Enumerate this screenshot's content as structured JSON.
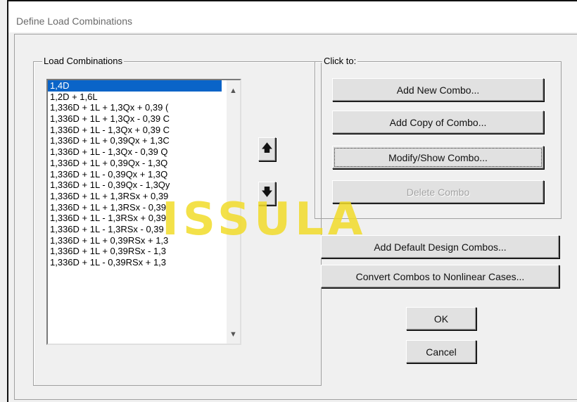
{
  "window": {
    "title": "Define Load Combinations"
  },
  "load_group": {
    "label": "Load Combinations",
    "items": [
      "1,4D",
      "1,2D + 1,6L",
      "1,336D + 1L + 1,3Qx + 0,39 (",
      "1,336D + 1L + 1,3Qx - 0,39 C",
      "1,336D + 1L - 1,3Qx + 0,39 C",
      "1,336D + 1L + 0,39Qx + 1,3C",
      "1,336D + 1L - 1,3Qx - 0,39 Q",
      "1,336D + 1L + 0,39Qx - 1,3Q",
      "1,336D + 1L - 0,39Qx + 1,3Q",
      "1,336D + 1L - 0,39Qx - 1,3Qy",
      "1,336D + 1L + 1,3RSx + 0,39",
      "1,336D + 1L + 1,3RSx - 0,39",
      "1,336D + 1L - 1,3RSx + 0,39",
      "1,336D + 1L - 1,3RSx - 0,39",
      "1,336D + 1L + 0,39RSx + 1,3",
      "1,336D + 1L + 0,39RSx - 1,3",
      "1,336D + 1L - 0,39RSx + 1,3"
    ]
  },
  "click_group": {
    "label": "Click to:",
    "add_new": "Add New Combo...",
    "add_copy": "Add Copy of Combo...",
    "modify": "Modify/Show Combo...",
    "delete": "Delete Combo"
  },
  "buttons": {
    "add_default": "Add Default Design Combos...",
    "convert": "Convert Combos to Nonlinear Cases...",
    "ok": "OK",
    "cancel": "Cancel"
  },
  "watermark": {
    "text": "ISSULA",
    "color": "#f2dc2a"
  }
}
